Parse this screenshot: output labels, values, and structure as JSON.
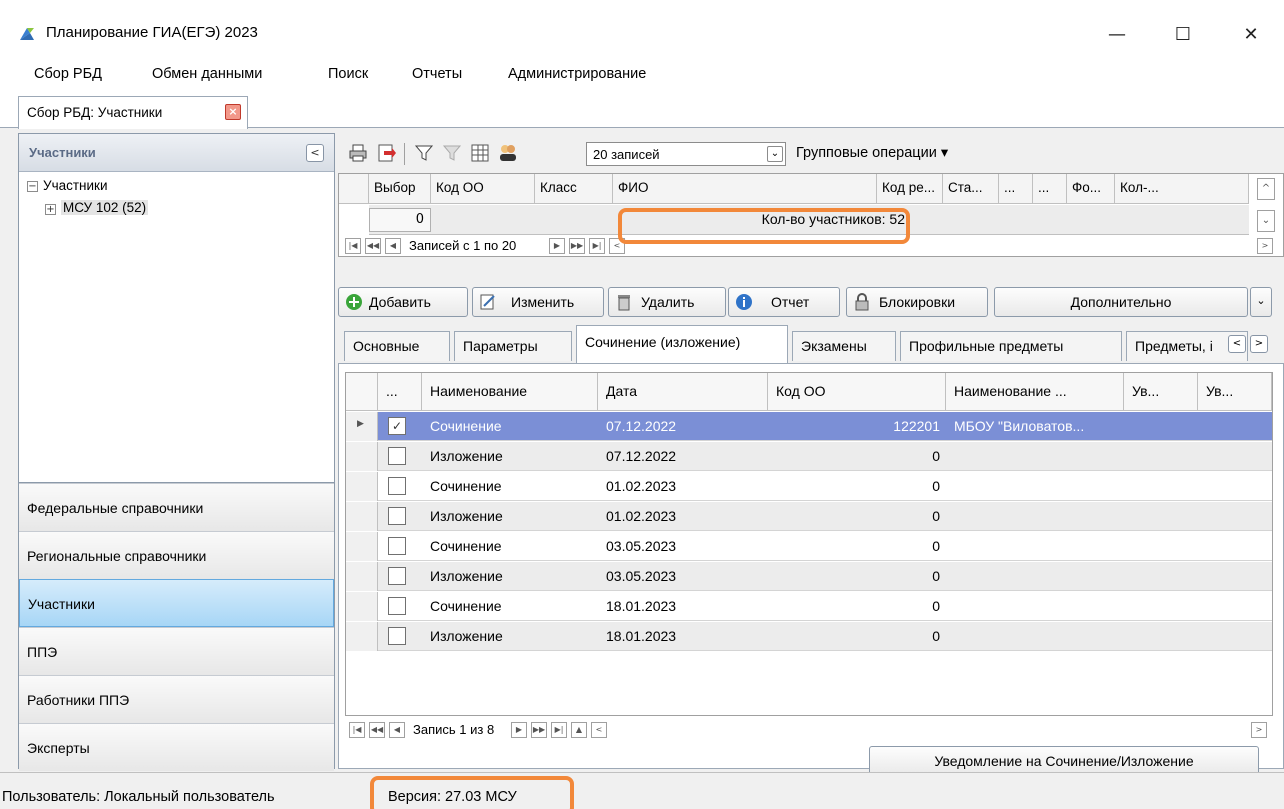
{
  "window": {
    "title": "Планирование ГИА(ЕГЭ) 2023",
    "minimize": "—",
    "maximize": "☐",
    "close": "✕"
  },
  "menu": [
    "Сбор РБД",
    "Обмен данными",
    "Поиск",
    "Отчеты",
    "Администрирование"
  ],
  "doc_tab": {
    "label": "Сбор РБД: Участники",
    "close": "×"
  },
  "left_panel": {
    "header": "Участники",
    "collapse": "<",
    "tree": {
      "root": "Участники",
      "root_toggle": "−",
      "child": "МСУ 102 (52)",
      "child_toggle": "+"
    },
    "nav": [
      "Федеральные справочники",
      "Региональные справочники",
      "Участники",
      "ППЭ",
      "Работники ППЭ",
      "Эксперты"
    ],
    "active_nav": "Участники"
  },
  "toolbar": {
    "records_value": "20 записей",
    "group_ops": "Групповые операции ▾",
    "combo_arrow": "⌄"
  },
  "participants_grid": {
    "columns": [
      "Выбор",
      "Код ОО",
      "Класс",
      "ФИО",
      "Код ре...",
      "Ста...",
      "...",
      "...",
      "Фо...",
      "Кол-..."
    ],
    "summary_zero": "0",
    "summary_count": "Кол-во участников: 52",
    "nav_text": "Записей с 1 по 20",
    "scroll_up": "^",
    "scroll_down": "⌄"
  },
  "actions": {
    "add": "Добавить",
    "edit": "Изменить",
    "delete": "Удалить",
    "report": "Отчет",
    "locks": "Блокировки",
    "more": "Дополнительно",
    "more_arrow": "⌄"
  },
  "subtabs": [
    "Основные",
    "Параметры",
    "Сочинение (изложение)",
    "Экзамены",
    "Профильные предметы",
    "Предметы, і"
  ],
  "active_subtab": "Сочинение (изложение)",
  "essay_grid": {
    "columns": [
      "...",
      "Наименование",
      "Дата",
      "Код ОО",
      "Наименование ...",
      "Ув...",
      "Ув..."
    ],
    "rows": [
      {
        "checked": true,
        "name": "Сочинение",
        "date": "07.12.2022",
        "code": "122201",
        "org": "МБОУ \"Виловатов..."
      },
      {
        "checked": false,
        "name": "Изложение",
        "date": "07.12.2022",
        "code": "0",
        "org": ""
      },
      {
        "checked": false,
        "name": "Сочинение",
        "date": "01.02.2023",
        "code": "0",
        "org": ""
      },
      {
        "checked": false,
        "name": "Изложение",
        "date": "01.02.2023",
        "code": "0",
        "org": ""
      },
      {
        "checked": false,
        "name": "Сочинение",
        "date": "03.05.2023",
        "code": "0",
        "org": ""
      },
      {
        "checked": false,
        "name": "Изложение",
        "date": "03.05.2023",
        "code": "0",
        "org": ""
      },
      {
        "checked": false,
        "name": "Сочинение",
        "date": "18.01.2023",
        "code": "0",
        "org": ""
      },
      {
        "checked": false,
        "name": "Изложение",
        "date": "18.01.2023",
        "code": "0",
        "org": ""
      }
    ],
    "nav_text": "Запись 1 из 8",
    "check_mark": "✓"
  },
  "notify_button": "Уведомление на Сочинение/Изложение",
  "status": {
    "user": "Пользователь: Локальный пользователь",
    "version": "Версия: 27.03  МСУ"
  },
  "colors": {
    "highlight": "#f2883a",
    "selected_row": "#7b8fd6",
    "active_nav": "#a7d6f6"
  }
}
